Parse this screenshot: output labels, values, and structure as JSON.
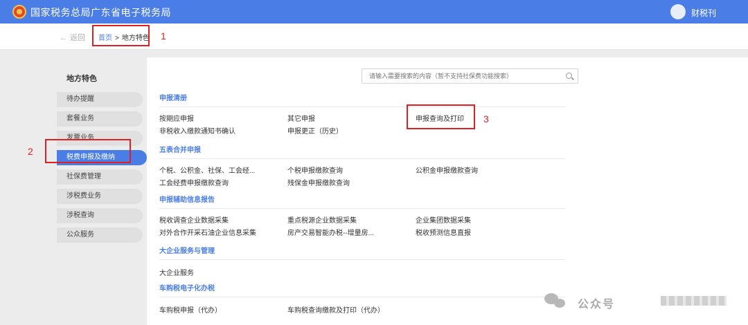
{
  "header": {
    "app_title": "国家税务总局广东省电子税务局",
    "user_name": "财税刊"
  },
  "breadcrumb": {
    "back_label": "返回",
    "home": "首页",
    "separator": ">",
    "current": "地方特色"
  },
  "annotations": [
    "1",
    "2",
    "3"
  ],
  "sidebar": {
    "title": "地方特色",
    "items": [
      {
        "label": "待办提醒"
      },
      {
        "label": "套餐业务"
      },
      {
        "label": "发票业务"
      },
      {
        "label": "税费申报及缴纳"
      },
      {
        "label": "社保费管理"
      },
      {
        "label": "涉税费业务"
      },
      {
        "label": "涉税查询"
      },
      {
        "label": "公众服务"
      }
    ]
  },
  "search": {
    "placeholder": "请输入需要搜索的内容（暂不支持社保费功能搜索）"
  },
  "sections": [
    {
      "title": "申报清册",
      "links": [
        "按期应申报",
        "其它申报",
        "申报查询及打印",
        "非税收入缴款通知书确认",
        "申报更正（历史）"
      ]
    },
    {
      "title": "五表合并申报",
      "links": [
        "个税、公积金、社保、工会经...",
        "个税申报缴款查询",
        "公积金申报缴款查询",
        "工会经费申报缴款查询",
        "残保金申报缴款查询"
      ]
    },
    {
      "title": "申报辅助信息报告",
      "links": [
        "税收调查企业数据采集",
        "重点税源企业数据采集",
        "企业集团数据采集",
        "对外合作开采石油企业信息采集",
        "房产交易智能办税--增量房...",
        "税收预测信息直报"
      ]
    },
    {
      "title": "大企业服务与管理",
      "links": [
        "大企业服务"
      ]
    },
    {
      "title": "车购税电子化办税",
      "links": [
        "车购税申报（代办）",
        "车购税查询缴款及打印（代办）"
      ]
    }
  ],
  "watermark": {
    "text": "公众号"
  }
}
